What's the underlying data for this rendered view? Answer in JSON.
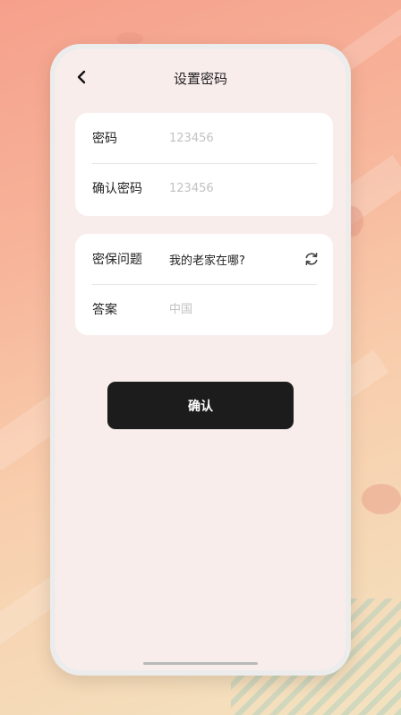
{
  "header": {
    "title": "设置密码"
  },
  "form": {
    "password": {
      "label": "密码",
      "placeholder": "123456"
    },
    "confirm_password": {
      "label": "确认密码",
      "placeholder": "123456"
    },
    "security_question": {
      "label": "密保问题",
      "value": "我的老家在哪?"
    },
    "answer": {
      "label": "答案",
      "placeholder": "中国"
    }
  },
  "actions": {
    "confirm_label": "确认"
  },
  "icons": {
    "back": "chevron-left-icon",
    "refresh": "refresh-icon"
  },
  "colors": {
    "screen_bg": "#f9edec",
    "card_bg": "#ffffff",
    "button_bg": "#1c1c1c",
    "button_text": "#ffffff"
  }
}
